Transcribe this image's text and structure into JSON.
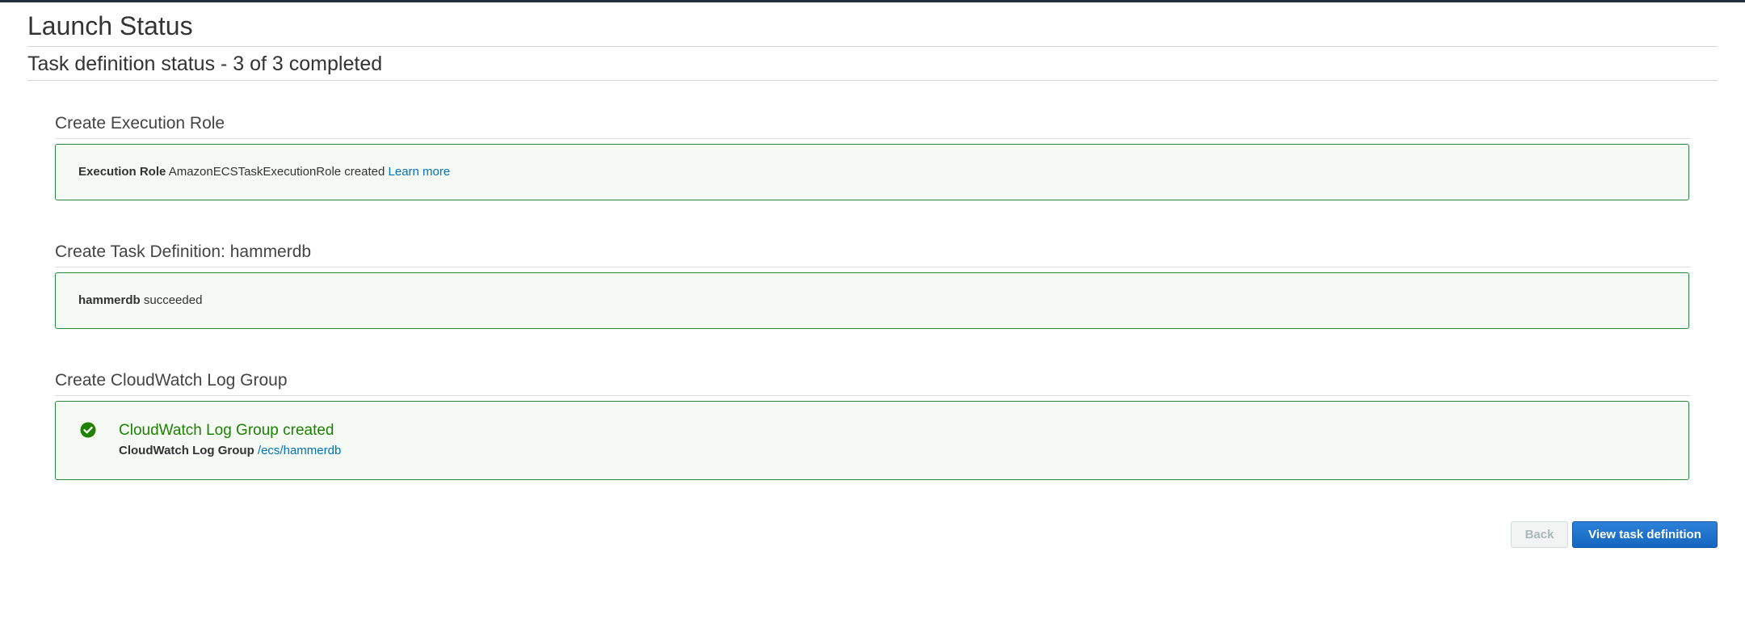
{
  "page": {
    "title": "Launch Status",
    "status": "Task definition status - 3 of 3 completed"
  },
  "sections": [
    {
      "title": "Create Execution Role",
      "label": "Execution Role",
      "text": "AmazonECSTaskExecutionRole created",
      "link": "Learn more"
    },
    {
      "title": "Create Task Definition: hammerdb",
      "label": "hammerdb",
      "text": "succeeded"
    },
    {
      "title": "Create CloudWatch Log Group",
      "heading": "CloudWatch Log Group created",
      "label": "CloudWatch Log Group",
      "link": "/ecs/hammerdb",
      "icon": "check-circle-icon"
    }
  ],
  "buttons": {
    "back": "Back",
    "view": "View task definition"
  },
  "colors": {
    "success": "#1d8102",
    "link": "#0073bb",
    "primary": "#1466c0"
  }
}
